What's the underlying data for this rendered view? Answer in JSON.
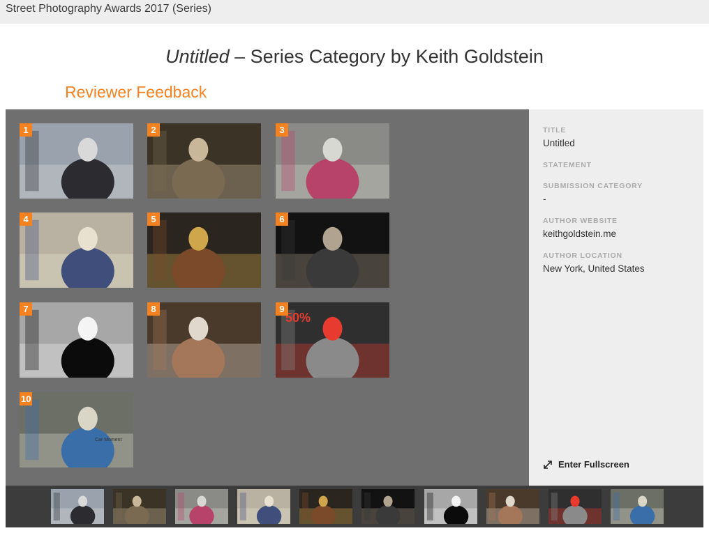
{
  "header": {
    "site_title": "Street Photography Awards 2017 (Series)"
  },
  "entry": {
    "title_italic": "Untitled",
    "title_rest": " – Series Category by Keith Goldstein"
  },
  "section_title": "Reviewer Feedback",
  "sidebar": {
    "fields": [
      {
        "label": "Title",
        "value": "Untitled"
      },
      {
        "label": "Statement",
        "value": ""
      },
      {
        "label": "Submission Category",
        "value": "-"
      },
      {
        "label": "Author Website",
        "value": "keithgoldstein.me"
      },
      {
        "label": "Author Location",
        "value": "New York, United States"
      }
    ],
    "fullscreen_label": "Enter Fullscreen",
    "fullscreen_icon": "expand-arrows-icon"
  },
  "photos": [
    {
      "number": "1",
      "colors": [
        "#9aa3ad",
        "#2b2b30",
        "#d9d9d9"
      ]
    },
    {
      "number": "2",
      "colors": [
        "#3a3326",
        "#7a6a52",
        "#c9b79a"
      ]
    },
    {
      "number": "3",
      "colors": [
        "#8a8a86",
        "#b8436a",
        "#d8d8d2"
      ]
    },
    {
      "number": "4",
      "colors": [
        "#b9b2a3",
        "#3f4e7a",
        "#e8e1cf"
      ]
    },
    {
      "number": "5",
      "colors": [
        "#2b2520",
        "#7b4a2a",
        "#d0a64c"
      ]
    },
    {
      "number": "6",
      "colors": [
        "#121212",
        "#3a3a3a",
        "#b0a490"
      ]
    },
    {
      "number": "7",
      "colors": [
        "#a7a7a7",
        "#0b0b0b",
        "#f4f4f4"
      ]
    },
    {
      "number": "8",
      "colors": [
        "#4a3a2c",
        "#a5775a",
        "#e0d8cc"
      ]
    },
    {
      "number": "9",
      "colors": [
        "#2f2f2f",
        "#8a8a8a",
        "#e63b2e"
      ]
    },
    {
      "number": "10",
      "colors": [
        "#6c6f66",
        "#3a6ea8",
        "#d9d6c8"
      ]
    }
  ],
  "photo_texts": {
    "poster": "50%",
    "sign": "Car Moment"
  }
}
